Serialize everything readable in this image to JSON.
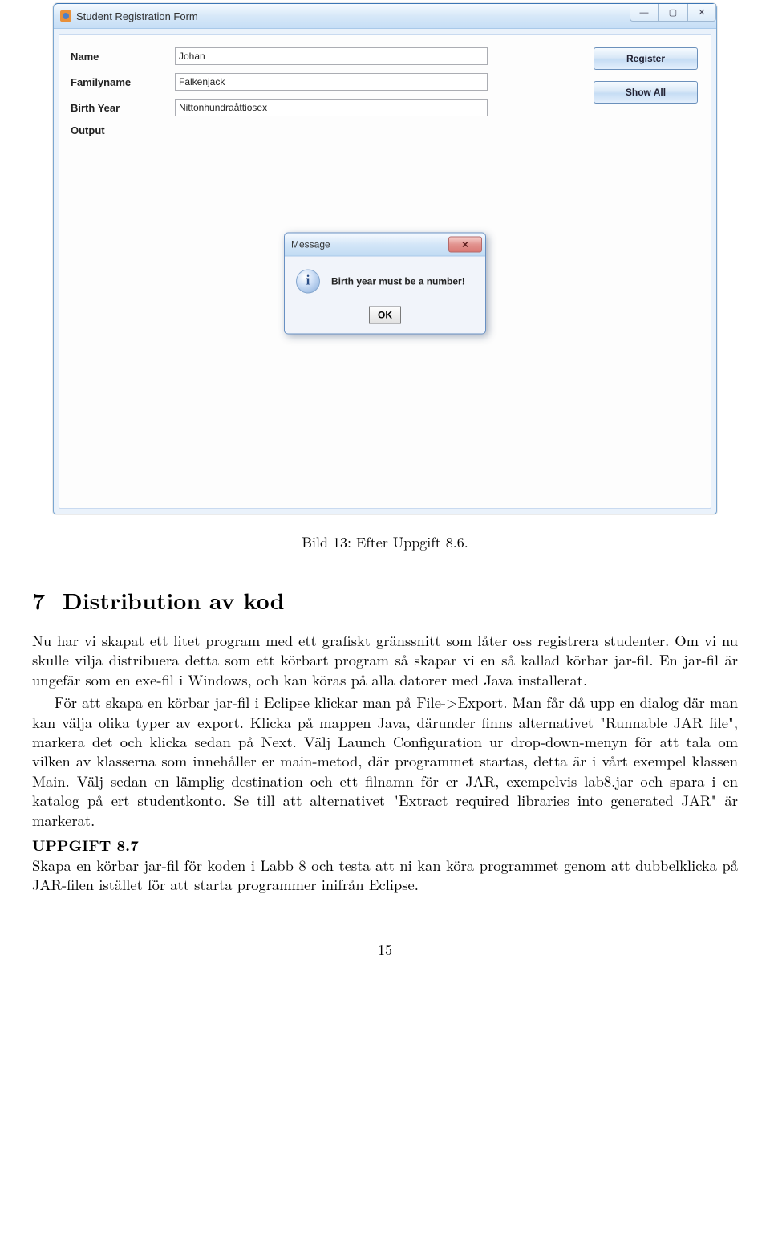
{
  "window": {
    "title": "Student Registration Form",
    "controls": {
      "min": "—",
      "max": "▢",
      "close": "✕"
    },
    "form": {
      "name_label": "Name",
      "name_value": "Johan",
      "family_label": "Familyname",
      "family_value": "Falkenjack",
      "birth_label": "Birth Year",
      "birth_value": "Nittonhundraåttiosex",
      "output_label": "Output"
    },
    "buttons": {
      "register": "Register",
      "show_all": "Show All"
    }
  },
  "dialog": {
    "title": "Message",
    "close": "✕",
    "text": "Birth year must be a number!",
    "ok": "OK"
  },
  "caption": "Bild 13: Efter Uppgift 8.6.",
  "section": {
    "num": "7",
    "title": "Distribution av kod"
  },
  "para1": "Nu har vi skapat ett litet program med ett grafiskt gränssnitt som låter oss registrera studenter. Om vi nu skulle vilja distribuera detta som ett körbart program så skapar vi en så kallad körbar jar-fil. En jar-fil är ungefär som en exe-fil i Windows, och kan köras på alla datorer med Java installerat.",
  "para2": "För att skapa en körbar jar-fil i Eclipse klickar man på File->Export. Man får då upp en dialog där man kan välja olika typer av export. Klicka på mappen Java, därunder finns alternativet \"Runnable JAR file\", markera det och klicka sedan på Next. Välj Launch Configuration ur drop-down-menyn för att tala om vilken av klasserna som innehåller er main-metod, där programmet startas, detta är i vårt exempel klassen Main. Välj sedan en lämplig destination och ett filnamn för er JAR, exempelvis lab8.jar och spara i en katalog på ert studentkonto. Se till att alternativet \"Extract required libraries into generated JAR\" är markerat.",
  "uppgift_label": "UPPGIFT 8.7",
  "para3": "Skapa en körbar jar-fil för koden i Labb 8 och testa att ni kan köra programmet genom att dubbelklicka på JAR-filen istället för att starta programmer inifrån Eclipse.",
  "pagenum": "15"
}
